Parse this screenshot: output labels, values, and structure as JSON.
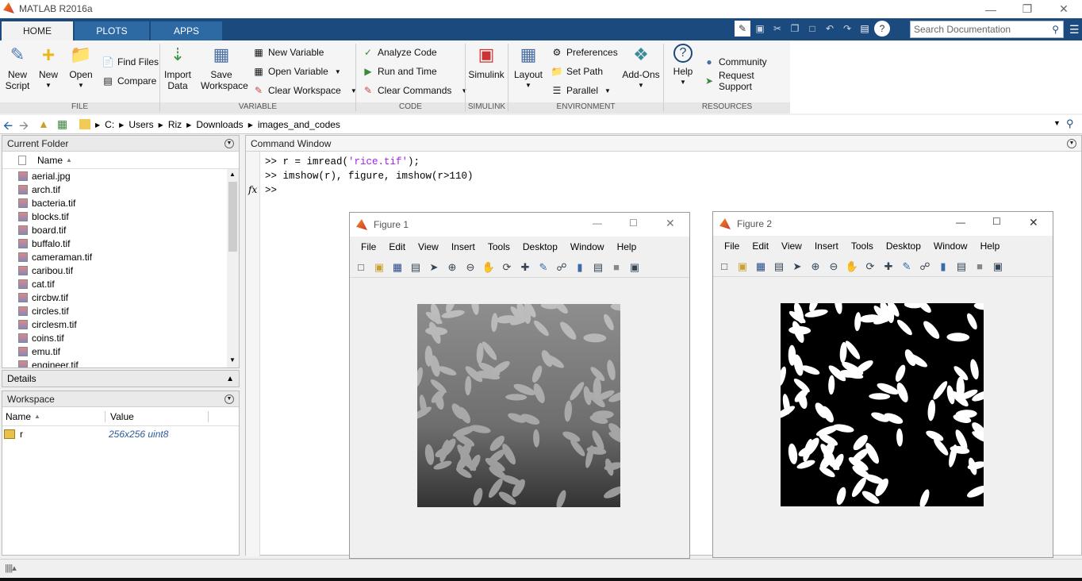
{
  "app": {
    "title": "MATLAB R2016a"
  },
  "tabs": [
    {
      "label": "HOME"
    },
    {
      "label": "PLOTS"
    },
    {
      "label": "APPS"
    }
  ],
  "search": {
    "placeholder": "Search Documentation"
  },
  "ribbon": {
    "new_script": "New Script",
    "new": "New",
    "open": "Open",
    "find_files": "Find Files",
    "compare": "Compare",
    "import_data": "Import Data",
    "save_workspace": "Save Workspace",
    "new_variable": "New Variable",
    "open_variable": "Open Variable",
    "clear_workspace": "Clear Workspace",
    "analyze_code": "Analyze Code",
    "run_and_time": "Run and Time",
    "clear_commands": "Clear Commands",
    "simulink": "Simulink",
    "layout": "Layout",
    "preferences": "Preferences",
    "set_path": "Set Path",
    "parallel": "Parallel",
    "add_ons": "Add-Ons",
    "help": "Help",
    "community": "Community",
    "request_support": "Request Support",
    "groups": {
      "file": "FILE",
      "variable": "VARIABLE",
      "code": "CODE",
      "simulink": "SIMULINK",
      "environment": "ENVIRONMENT",
      "resources": "RESOURCES"
    }
  },
  "address": {
    "path": [
      "C:",
      "Users",
      "Riz",
      "Downloads",
      "images_and_codes"
    ]
  },
  "current_folder": {
    "title": "Current Folder",
    "column": "Name",
    "files": [
      "aerial.jpg",
      "arch.tif",
      "bacteria.tif",
      "blocks.tif",
      "board.tif",
      "buffalo.tif",
      "cameraman.tif",
      "caribou.tif",
      "cat.tif",
      "circbw.tif",
      "circles.tif",
      "circlesm.tif",
      "coins.tif",
      "emu.tif",
      "engineer.tif"
    ]
  },
  "details": {
    "title": "Details"
  },
  "workspace": {
    "title": "Workspace",
    "col_name": "Name",
    "col_value": "Value",
    "rows": [
      {
        "name": "r",
        "value": "256x256 uint8"
      }
    ]
  },
  "command_window": {
    "title": "Command Window",
    "lines": [
      {
        "prompt": ">> ",
        "pre": "r = imread(",
        "str": "'rice.tif'",
        "post": ");"
      },
      {
        "prompt": ">> ",
        "pre": "imshow(r), figure, imshow(r>110)",
        "str": "",
        "post": ""
      }
    ],
    "fx": "fx",
    "current_prompt": ">>"
  },
  "figure1": {
    "title": "Figure 1",
    "menu": [
      "File",
      "Edit",
      "View",
      "Insert",
      "Tools",
      "Desktop",
      "Window",
      "Help"
    ]
  },
  "figure2": {
    "title": "Figure 2",
    "menu": [
      "File",
      "Edit",
      "View",
      "Insert",
      "Tools",
      "Desktop",
      "Window",
      "Help"
    ]
  }
}
